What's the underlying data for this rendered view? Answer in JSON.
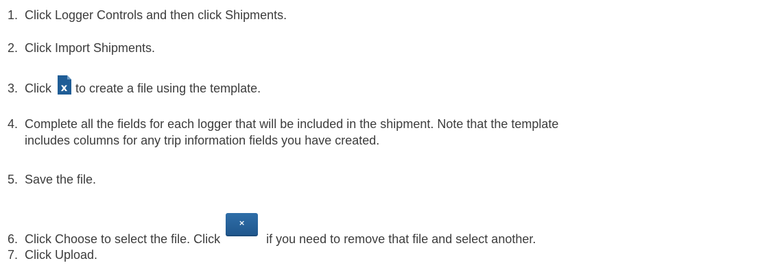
{
  "steps": [
    {
      "number": "1.",
      "text": "Click Logger Controls and then click Shipments."
    },
    {
      "number": "2.",
      "text": "Click Import Shipments."
    },
    {
      "number": "3.",
      "before": "Click",
      "icon": "excel-file-icon",
      "after": "to create a file using the template."
    },
    {
      "number": "4.",
      "line1": "Complete all the fields for each logger that will be included in the shipment. Note that the template",
      "line2": "includes columns for any trip information fields you have created."
    },
    {
      "number": "5.",
      "text": "Save the file."
    },
    {
      "number": "6.",
      "before": "Click Choose to select the file. Click",
      "icon": "remove-file-icon",
      "icon_glyph": "×",
      "after": "if you need to remove that file and select another."
    },
    {
      "number": "7.",
      "text": "Click Upload."
    }
  ],
  "colors": {
    "text": "#3c3c3c",
    "icon_blue": "#1f5d96",
    "icon_letter": "#ffffff"
  }
}
